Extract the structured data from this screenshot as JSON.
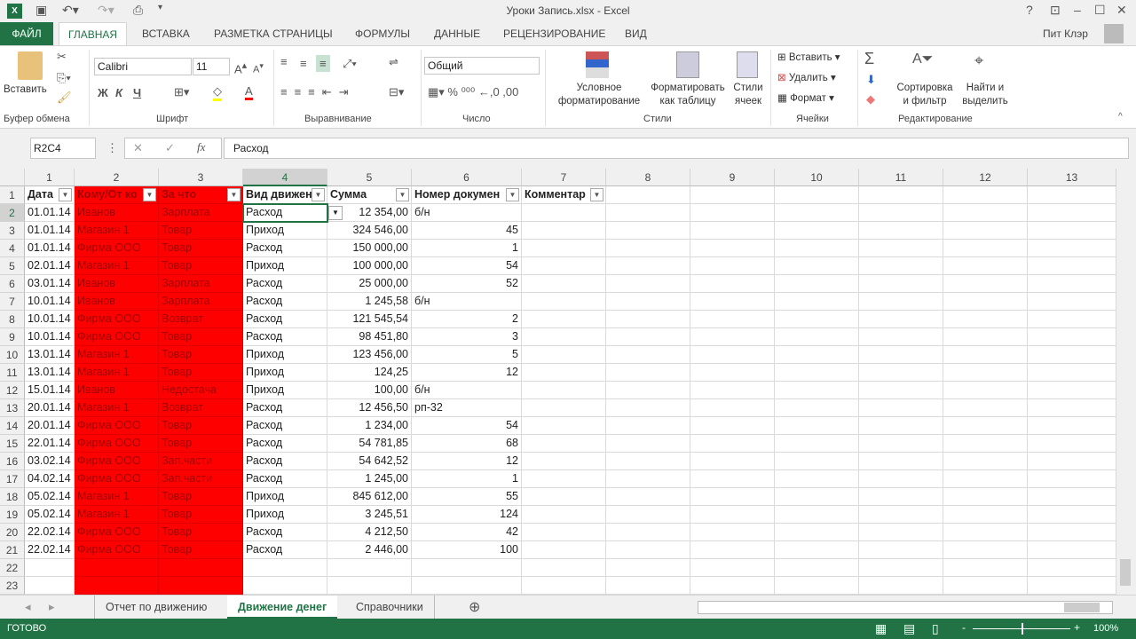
{
  "title": "Уроки Запись.xlsx - Excel",
  "user": "Пит Клэр",
  "tabs": [
    "ФАЙЛ",
    "ГЛАВНАЯ",
    "ВСТАВКА",
    "РАЗМЕТКА СТРАНИЦЫ",
    "ФОРМУЛЫ",
    "ДАННЫЕ",
    "РЕЦЕНЗИРОВАНИЕ",
    "ВИД"
  ],
  "ribbon": {
    "paste": "Вставить",
    "clipboard": "Буфер обмена",
    "font_name": "Calibri",
    "font_size": "11",
    "font": "Шрифт",
    "bold": "Ж",
    "italic": "К",
    "underline": "Ч",
    "alignment": "Выравнивание",
    "number_format": "Общий",
    "number": "Число",
    "cond1": "Условное",
    "cond2": "форматирование",
    "fmt1": "Форматировать",
    "fmt2": "как таблицу",
    "styles1": "Стили",
    "styles2": "ячеек",
    "styles": "Стили",
    "insert": "Вставить",
    "delete": "Удалить",
    "format": "Формат",
    "cells": "Ячейки",
    "sort1": "Сортировка",
    "sort2": "и фильтр",
    "find1": "Найти и",
    "find2": "выделить",
    "editing": "Редактирование"
  },
  "namebox": "R2C4",
  "formula": "Расход",
  "columns": [
    "1",
    "2",
    "3",
    "4",
    "5",
    "6",
    "7",
    "8",
    "9",
    "10",
    "11",
    "12",
    "13"
  ],
  "headers": [
    "Дата",
    "Кому/От ко",
    "За что",
    "Вид движен",
    "Сумма",
    "Номер докумен",
    "Комментар"
  ],
  "rows": [
    [
      "01.01.14",
      "Иванов",
      "Зарплата",
      "Расход",
      "12 354,00",
      "б/н"
    ],
    [
      "01.01.14",
      "Магазин 1",
      "Товар",
      "Приход",
      "324 546,00",
      "45"
    ],
    [
      "01.01.14",
      "Фирма ООО",
      "Товар",
      "Расход",
      "150 000,00",
      "1"
    ],
    [
      "02.01.14",
      "Магазин 1",
      "Товар",
      "Приход",
      "100 000,00",
      "54"
    ],
    [
      "03.01.14",
      "Иванов",
      "Зарплата",
      "Расход",
      "25 000,00",
      "52"
    ],
    [
      "10.01.14",
      "Иванов",
      "Зарплата",
      "Расход",
      "1 245,58",
      "б/н"
    ],
    [
      "10.01.14",
      "Фирма ООО",
      "Возврат",
      "Расход",
      "121 545,54",
      "2"
    ],
    [
      "10.01.14",
      "Фирма ООО",
      "Товар",
      "Расход",
      "98 451,80",
      "3"
    ],
    [
      "13.01.14",
      "Магазин 1",
      "Товар",
      "Приход",
      "123 456,00",
      "5"
    ],
    [
      "13.01.14",
      "Магазин 1",
      "Товар",
      "Приход",
      "124,25",
      "12"
    ],
    [
      "15.01.14",
      "Иванов",
      "Недостача",
      "Приход",
      "100,00",
      "б/н"
    ],
    [
      "20.01.14",
      "Магазин 1",
      "Возврат",
      "Расход",
      "12 456,50",
      "рп-32"
    ],
    [
      "20.01.14",
      "Фирма ООО",
      "Товар",
      "Расход",
      "1 234,00",
      "54"
    ],
    [
      "22.01.14",
      "Фирма ООО",
      "Товар",
      "Расход",
      "54 781,85",
      "68"
    ],
    [
      "03.02.14",
      "Фирма ООО",
      "Зап.части",
      "Расход",
      "54 642,52",
      "12"
    ],
    [
      "04.02.14",
      "Фирма ООО",
      "Зап.части",
      "Расход",
      "1 245,00",
      "1"
    ],
    [
      "05.02.14",
      "Магазин 1",
      "Товар",
      "Приход",
      "845 612,00",
      "55"
    ],
    [
      "05.02.14",
      "Магазин 1",
      "Товар",
      "Приход",
      "3 245,51",
      "124"
    ],
    [
      "22.02.14",
      "Фирма ООО",
      "Товар",
      "Расход",
      "4 212,50",
      "42"
    ],
    [
      "22.02.14",
      "Фирма ООО",
      "Товар",
      "Расход",
      "2 446,00",
      "100"
    ]
  ],
  "sheets": [
    "Отчет по движению",
    "Движение денег",
    "Справочники"
  ],
  "status": "ГОТОВО",
  "zoom": "100%"
}
